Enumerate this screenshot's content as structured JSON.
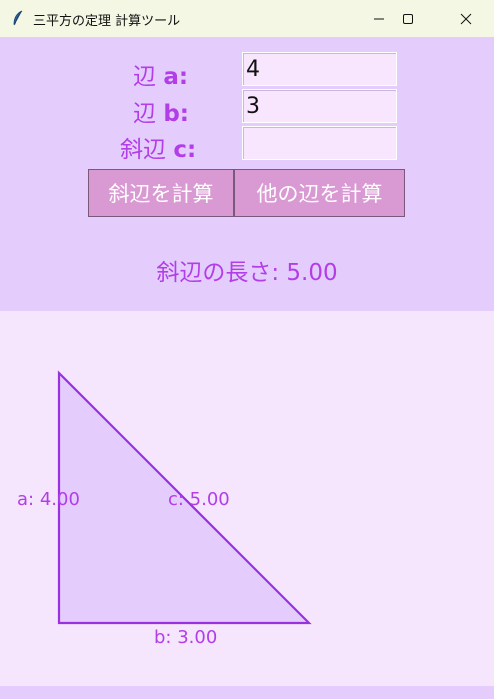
{
  "window": {
    "title": "三平方の定理 計算ツール",
    "app_icon": "feather-icon",
    "controls": [
      "minimize-icon",
      "maximize-icon",
      "close-icon"
    ]
  },
  "form": {
    "side_a_label_jp": "辺",
    "side_a_label_var": "a:",
    "side_a_value": "4",
    "side_b_label_jp": "辺",
    "side_b_label_var": "b:",
    "side_b_value": "3",
    "hyp_label_jp": "斜辺",
    "hyp_label_var": "c:",
    "hyp_value": ""
  },
  "buttons": {
    "calc_hypotenuse": "斜辺を計算",
    "calc_other_side": "他の辺を計算"
  },
  "result": {
    "label": "斜辺の長さ:",
    "value": "5.00"
  },
  "triangle": {
    "a": 4.0,
    "b": 3.0,
    "c": 5.0,
    "label_a": "a: 4.00",
    "label_b": "b: 3.00",
    "label_c": "c: 5.00"
  },
  "colors": {
    "accent": "#b23ee7",
    "panel_bg": "#e4cdfd",
    "canvas_bg": "#f5e6fe",
    "button_bg": "#d99ad3",
    "triangle_fill": "#e4cdfd",
    "triangle_stroke": "#9b30e0",
    "titlebar_bg": "#f3f7e3"
  }
}
